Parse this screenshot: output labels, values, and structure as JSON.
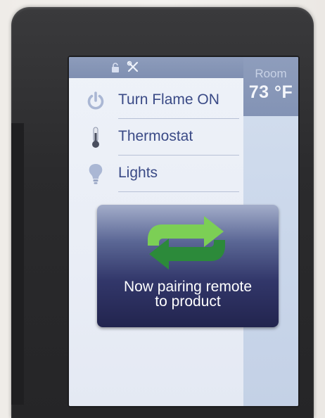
{
  "status_bar": {
    "icons": [
      "lock-icon",
      "tools-icon"
    ]
  },
  "room": {
    "label": "Room",
    "temperature": "73 °F"
  },
  "menu": {
    "items": [
      {
        "icon": "power-icon",
        "label": "Turn Flame ON"
      },
      {
        "icon": "thermometer-icon",
        "label": "Thermostat"
      },
      {
        "icon": "light-bulb-icon",
        "label": "Lights"
      }
    ]
  },
  "dialog": {
    "icon": "sync-icon",
    "message": "Now pairing remote\nto product"
  },
  "colors": {
    "header": "#8393b5",
    "text": "#3a4a86",
    "sync_green_dark": "#2c8a3a",
    "sync_green_light": "#7ccf55"
  }
}
